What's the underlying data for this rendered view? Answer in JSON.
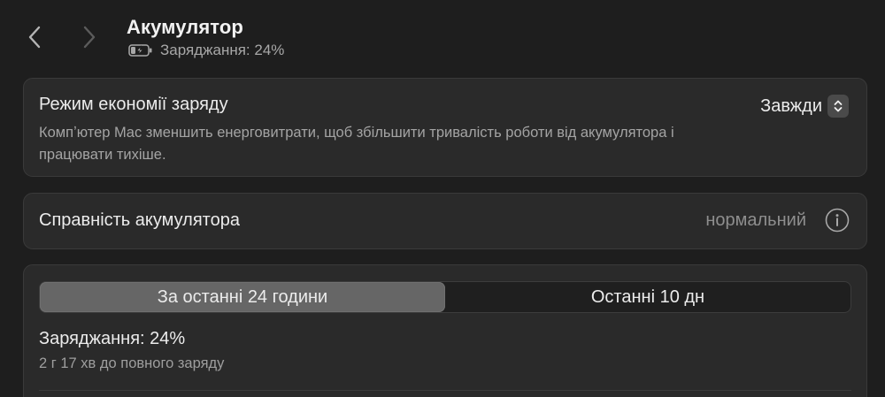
{
  "header": {
    "back_icon": "chevron-left-icon",
    "forward_icon": "chevron-right-icon",
    "title": "Акумулятор",
    "battery_icon": "battery-charging-icon",
    "status": "Заряджання: 24%"
  },
  "power_mode": {
    "title": "Режим економії заряду",
    "description": "Компʼютер Mac зменшить енерговитрати, щоб збільшити тривалість роботи від акумулятора і працювати тихіше.",
    "value": "Завжди",
    "stepper_icon": "up-down-chevron-icon"
  },
  "battery_health": {
    "label": "Справність акумулятора",
    "value": "нормальний",
    "info_icon": "info-icon"
  },
  "usage": {
    "tabs": [
      {
        "label": "За останні 24 години",
        "selected": true
      },
      {
        "label": "Останні 10 дн",
        "selected": false
      }
    ],
    "charge_text": "Заряджання: 24%",
    "time_to_full": "2 г 17 хв до повного заряду"
  },
  "colors": {
    "background": "#1e1e1e",
    "card": "#2a2a2a",
    "selected_tab": "#666666",
    "secondary_text": "#a4a4a4"
  }
}
